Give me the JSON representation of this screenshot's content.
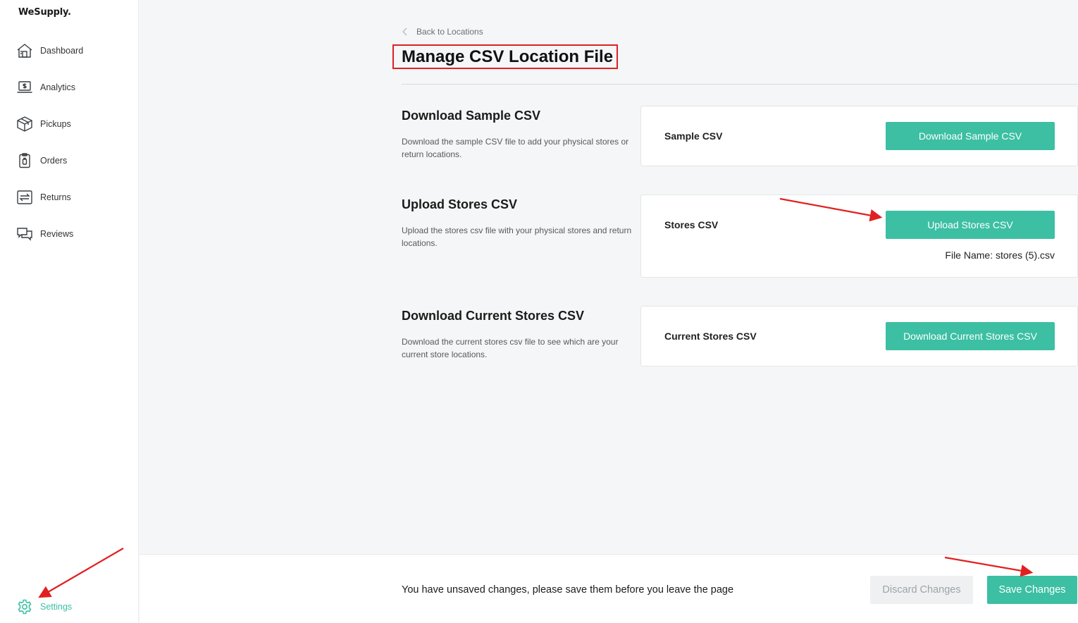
{
  "sidebar": {
    "logo": "WeSupply.",
    "items": [
      {
        "label": "Dashboard",
        "icon": "house-icon"
      },
      {
        "label": "Analytics",
        "icon": "laptop-dollar-icon"
      },
      {
        "label": "Pickups",
        "icon": "box-icon"
      },
      {
        "label": "Orders",
        "icon": "clipboard-icon"
      },
      {
        "label": "Returns",
        "icon": "return-arrows-icon"
      },
      {
        "label": "Reviews",
        "icon": "chat-bubbles-icon"
      }
    ],
    "settings": {
      "label": "Settings",
      "icon": "gear-icon"
    }
  },
  "header": {
    "back_label": "Back to Locations",
    "title": "Manage CSV Location File"
  },
  "sections": [
    {
      "title": "Download Sample CSV",
      "description": "Download the sample CSV file to add your physical stores or return locations.",
      "card_label": "Sample CSV",
      "button_label": "Download Sample CSV"
    },
    {
      "title": "Upload Stores CSV",
      "description": "Upload the stores csv file with your physical stores and return locations.",
      "card_label": "Stores CSV",
      "button_label": "Upload Stores CSV",
      "file_name": "File Name: stores (5).csv"
    },
    {
      "title": "Download Current Stores CSV",
      "description": "Download the current stores csv file to see which are your current store locations.",
      "card_label": "Current Stores CSV",
      "button_label": "Download Current Stores CSV"
    }
  ],
  "footer": {
    "message": "You have unsaved changes, please save them before you leave the page",
    "discard_label": "Discard Changes",
    "save_label": "Save Changes"
  },
  "colors": {
    "accent": "#3cbfa3",
    "highlight_border": "#e02020",
    "annotation_arrow": "#e02020"
  }
}
